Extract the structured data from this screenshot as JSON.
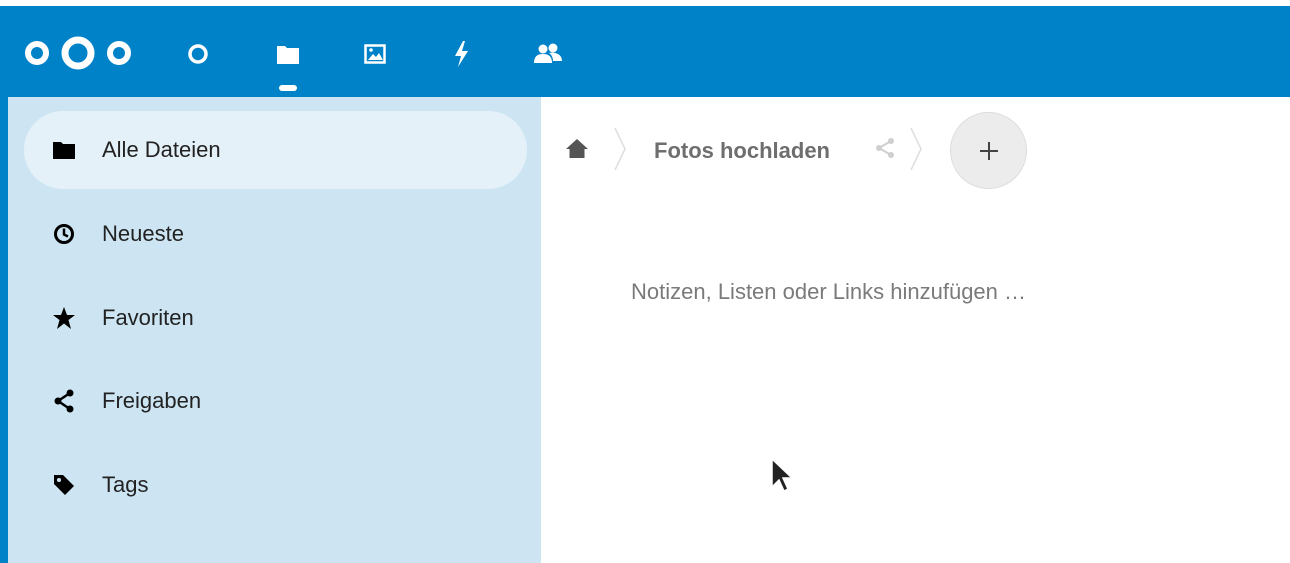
{
  "header": {
    "background_color": "#0082c9",
    "logo_icon": "nextcloud-logo",
    "apps": [
      {
        "name": "dashboard",
        "icon": "circle-icon",
        "active": false
      },
      {
        "name": "files",
        "icon": "folder-icon",
        "active": true
      },
      {
        "name": "photos",
        "icon": "image-icon",
        "active": false
      },
      {
        "name": "activity",
        "icon": "lightning-icon",
        "active": false
      },
      {
        "name": "contacts",
        "icon": "users-icon",
        "active": false
      }
    ]
  },
  "sidebar": {
    "background_color": "#cde5f3",
    "items": [
      {
        "label": "Alle Dateien",
        "icon": "folder-icon",
        "active": true
      },
      {
        "label": "Neueste",
        "icon": "clock-icon",
        "active": false
      },
      {
        "label": "Favoriten",
        "icon": "star-icon",
        "active": false
      },
      {
        "label": "Freigaben",
        "icon": "share-icon",
        "active": false
      },
      {
        "label": "Tags",
        "icon": "tag-icon",
        "active": false
      }
    ]
  },
  "main": {
    "breadcrumb": {
      "home_icon": "home-icon",
      "folder": "Fotos hochladen",
      "share_icon": "share-icon"
    },
    "new_button_icon": "plus-icon",
    "notes_placeholder": "Notizen, Listen oder Links hinzufügen …"
  }
}
